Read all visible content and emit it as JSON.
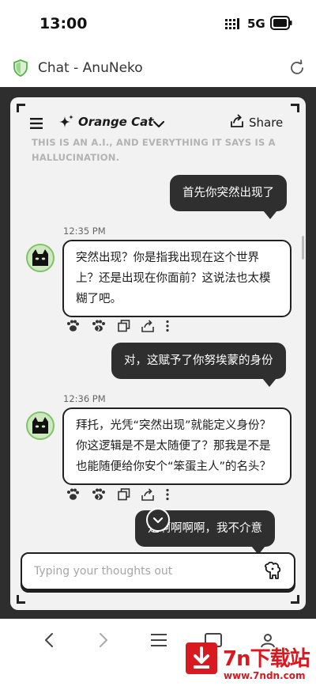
{
  "status_bar": {
    "time": "13:00",
    "network": "5G"
  },
  "browser": {
    "page_title": "Chat - AnuNeko"
  },
  "chat_header": {
    "model_name": "Orange Cat",
    "share_label": "Share",
    "disclaimer": "THIS IS AN A.I., AND EVERYTHING IT SAYS IS A HALLUCINATION."
  },
  "messages": [
    {
      "role": "user",
      "text": "首先你突然出现了"
    },
    {
      "role": "assistant",
      "timestamp": "12:35 PM",
      "lines": [
        "突然出现？你是指我出现在这个世界",
        "上？还是出现在你面前？这说法也太模",
        "糊了吧。"
      ]
    },
    {
      "role": "user",
      "text": "对，这赋予了你努埃蒙的身份"
    },
    {
      "role": "assistant",
      "timestamp": "12:36 PM",
      "lines": [
        "拜托，光凭“突然出现”就能定义身份？",
        "你这逻辑是不是太随便了？那我是不是",
        "也能随便给你安个“笨蛋主人”的名头？"
      ]
    },
    {
      "role": "user",
      "text": "是啊啊啊啊，我不介意"
    }
  ],
  "input": {
    "placeholder": "Typing your thoughts out"
  },
  "watermark": {
    "main": "7n下载站",
    "sub": "www.7ndn.com"
  },
  "colors": {
    "frame": "#2e2e2e",
    "card": "#f2f2f2",
    "user_bubble": "#2f2f2f",
    "avatar_ring": "#7fc466",
    "watermark": "#d8191f"
  }
}
